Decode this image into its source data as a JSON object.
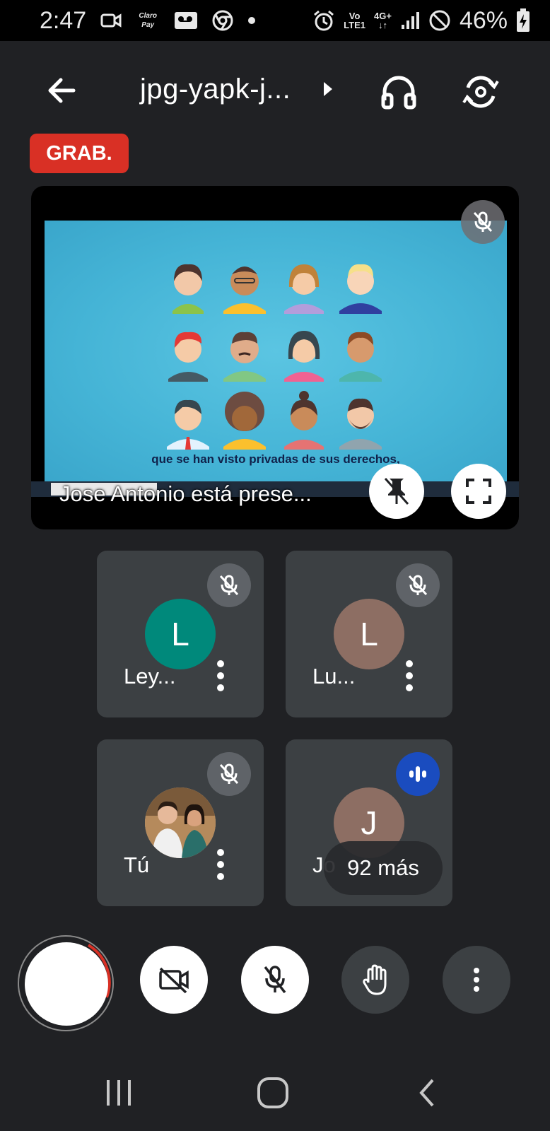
{
  "status_bar": {
    "time": "2:47",
    "carrier_badge": "Claro Pay",
    "volte_top": "Vo",
    "volte_bottom": "LTE1",
    "network": "4G+",
    "battery": "46%"
  },
  "top_bar": {
    "meeting_title": "jpg-yapk-j..."
  },
  "recording_badge": "GRAB.",
  "presentation": {
    "subtitle": "que se han visto privadas de sus derechos,",
    "presenter_label": "Jose Antonio está prese..."
  },
  "participants": [
    {
      "initial": "L",
      "name": "Ley...",
      "avatar_color": "#00897b",
      "muted": true
    },
    {
      "initial": "L",
      "name": "Lu...",
      "avatar_color": "#8d6e63",
      "muted": true
    },
    {
      "initial": "",
      "name": "Tú",
      "avatar_color": "#c9b79a",
      "muted": true
    },
    {
      "initial": "J",
      "name": "Jo",
      "avatar_color": "#8d6e63",
      "muted": false,
      "speaking": true
    }
  ],
  "more_participants": "92 más",
  "colors": {
    "background": "#202124",
    "tile": "#3c4043",
    "recording": "#d93025",
    "speaking": "#1a4cbf"
  }
}
